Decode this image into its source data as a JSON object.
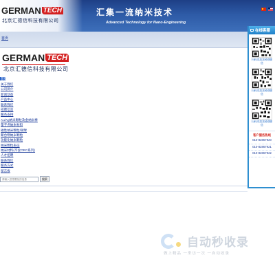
{
  "brand": {
    "logo_german": "GERMAN",
    "logo_tech": "TECH",
    "company_cn": "北京汇德信科技有限公司"
  },
  "header": {
    "slogan_cn": "汇集一流纳米技术",
    "slogan_en": "Advanced Technology for Nano-Engineering"
  },
  "nav": {
    "home": "首页"
  },
  "menu": {
    "items": [
      {
        "label": "首页",
        "active": true
      },
      {
        "label": "关于我们"
      },
      {
        "label": "公司简介"
      },
      {
        "label": "新闻动态"
      },
      {
        "label": "产品中心"
      },
      {
        "label": "联系我们"
      },
      {
        "label": "招聘信息"
      },
      {
        "label": "服务支持"
      },
      {
        "label": "Au/Ag纳米颗粒及金纳米棒"
      },
      {
        "label": "量子点纳米材料"
      },
      {
        "label": "磁性纳米颗粒/微球"
      },
      {
        "label": "聚合物纳米颗粒"
      },
      {
        "label": "功能化纳米颗粒"
      },
      {
        "label": "纳米颗粒表征"
      },
      {
        "label": "纳米材料(不含ORC系列)"
      },
      {
        "label": "人才招聘"
      },
      {
        "label": "联系我们"
      },
      {
        "label": "服务方式"
      },
      {
        "label": "留言板"
      }
    ]
  },
  "search": {
    "placeholder": "请输入您想要找的信息",
    "button": "搜索"
  },
  "side_panel": {
    "title": "在线客服",
    "qr_codes": [
      {
        "caption": "扫码添加沈经理微信"
      },
      {
        "caption": "扫码添加沈经理微信"
      },
      {
        "caption": "扫码添加沈经理微信"
      }
    ],
    "hotline_title": "客户服务热线",
    "phones": [
      "010-82867920",
      "010-82867921",
      "010-82867922"
    ]
  },
  "watermark": {
    "text": "自动秒收录",
    "sub": "做上精品 一来访一次 一自动收录"
  },
  "colors": {
    "banner": "#2d5aa6",
    "accent_red": "#d42020",
    "link": "#1a3a9a",
    "side_border": "#2e8fd0"
  }
}
